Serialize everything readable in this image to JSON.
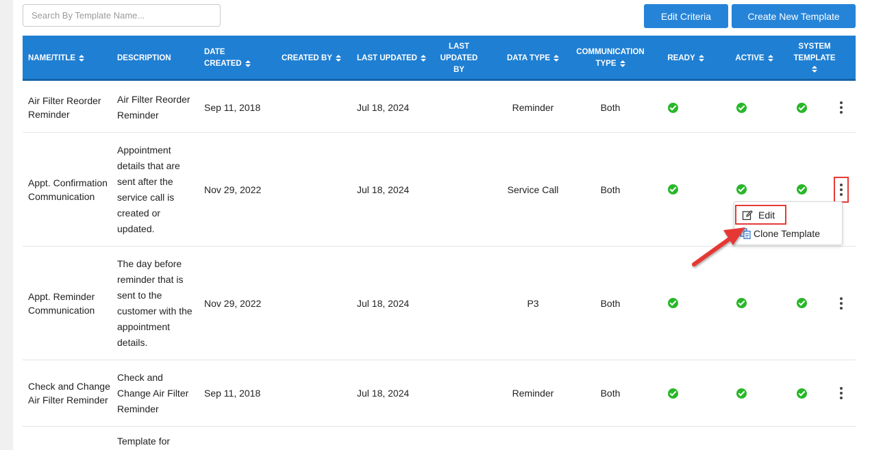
{
  "search": {
    "placeholder": "Search By Template Name..."
  },
  "toolbar": {
    "edit_criteria_label": "Edit Criteria",
    "create_label": "Create New Template"
  },
  "table": {
    "headers": {
      "name": "NAME/TITLE",
      "description": "DESCRIPTION",
      "date_created": "DATE CREATED",
      "created_by": "CREATED BY",
      "last_updated": "LAST UPDATED",
      "last_updated_by": "LAST UPDATED BY",
      "data_type": "DATA TYPE",
      "communication_type": "COMMUNICATION TYPE",
      "ready": "READY",
      "active": "ACTIVE",
      "system_template": "SYSTEM TEMPLATE"
    },
    "rows": [
      {
        "name": "Air Filter Reorder Reminder",
        "description": "Air Filter Reorder Reminder",
        "date_created": "Sep 11, 2018",
        "created_by": "",
        "last_updated": "Jul 18, 2024",
        "last_updated_by": "",
        "data_type": "Reminder",
        "communication_type": "Both",
        "ready": true,
        "active": true,
        "system_template": true
      },
      {
        "name": "Appt. Confirmation Communication",
        "description": "Appointment details that are sent after the service call is created or updated.",
        "date_created": "Nov 29, 2022",
        "created_by": "",
        "last_updated": "Jul 18, 2024",
        "last_updated_by": "",
        "data_type": "Service Call",
        "communication_type": "Both",
        "ready": true,
        "active": true,
        "system_template": true
      },
      {
        "name": "Appt. Reminder Communication",
        "description": "The day before reminder that is sent to the customer with the appointment details.",
        "date_created": "Nov 29, 2022",
        "created_by": "",
        "last_updated": "Jul 18, 2024",
        "last_updated_by": "",
        "data_type": "P3",
        "communication_type": "Both",
        "ready": true,
        "active": true,
        "system_template": true
      },
      {
        "name": "Check and Change Air Filter Reminder",
        "description": "Check and Change Air Filter Reminder",
        "date_created": "Sep 11, 2018",
        "created_by": "",
        "last_updated": "Jul 18, 2024",
        "last_updated_by": "",
        "data_type": "Reminder",
        "communication_type": "Both",
        "ready": true,
        "active": true,
        "system_template": true
      },
      {
        "name": "",
        "description": "Template for",
        "date_created": "",
        "created_by": "",
        "last_updated": "",
        "last_updated_by": "",
        "data_type": "",
        "communication_type": "",
        "ready": false,
        "active": false,
        "system_template": false
      }
    ]
  },
  "context_menu": {
    "edit_label": "Edit",
    "clone_label": "Clone Template"
  },
  "colors": {
    "header_bg": "#1f7fd3",
    "button_bg": "#2684d8",
    "check_green": "#28b728",
    "highlight_red": "#e53935"
  },
  "icons": [
    "sort-icon",
    "check-circle-icon",
    "kebab-menu-icon",
    "edit-icon",
    "clone-icon",
    "arrow-annotation"
  ]
}
